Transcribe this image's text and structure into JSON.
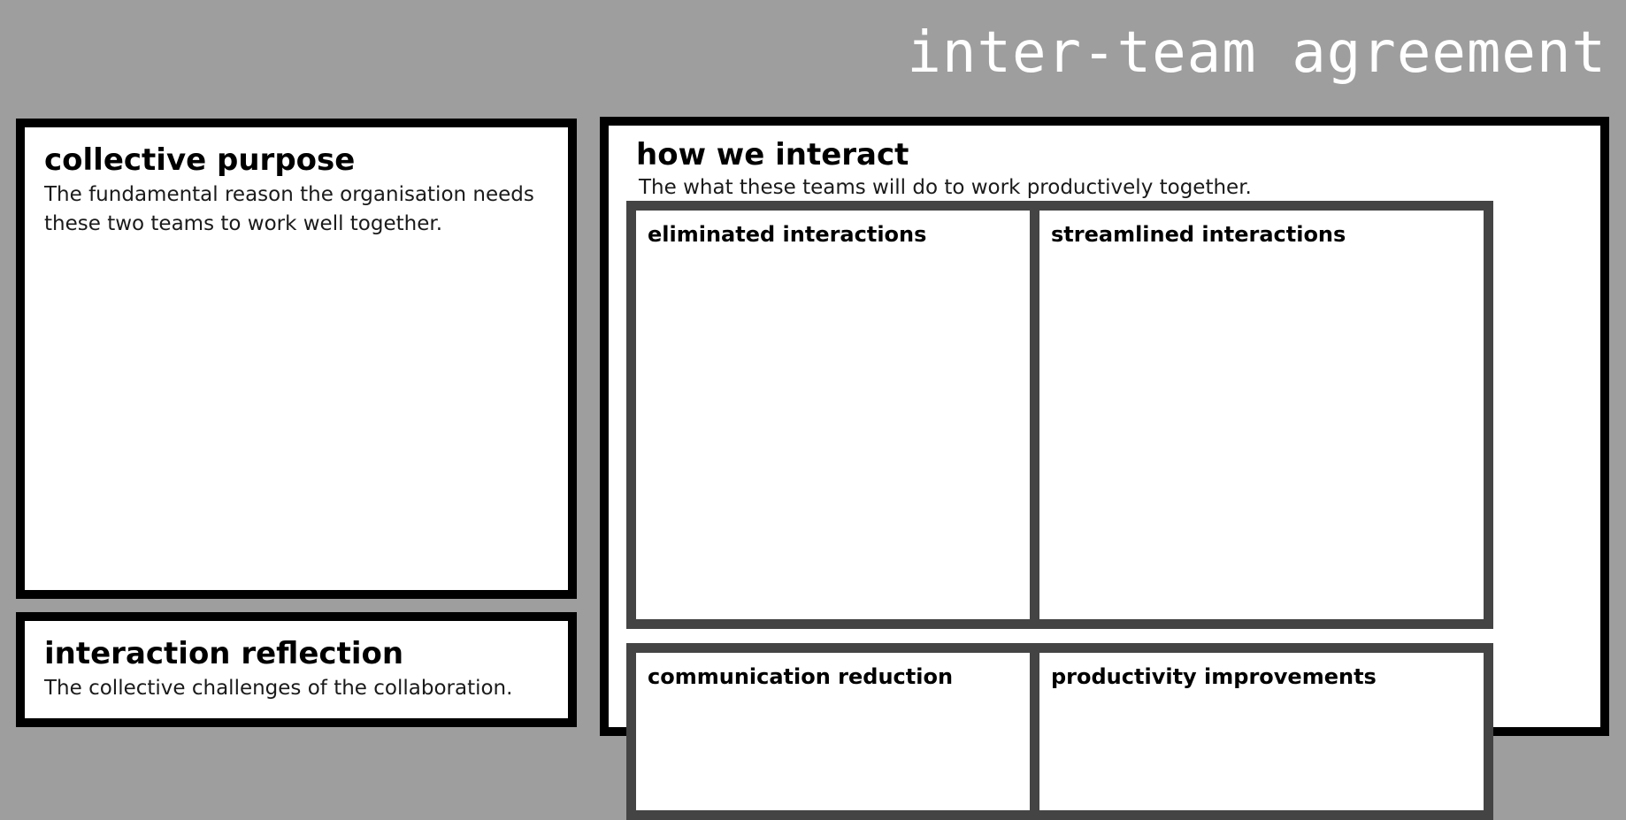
{
  "title": "inter-team agreement",
  "panels": {
    "collective_purpose": {
      "heading": "collective purpose",
      "description": "The fundamental reason the organisation needs these two teams to work well together."
    },
    "interaction_reflection": {
      "heading": "interaction reflection",
      "description": "The collective challenges of the collaboration."
    },
    "how_we_interact": {
      "heading": "how we interact",
      "description": "The what these teams will do to work productively together.",
      "boxes": {
        "eliminated": "eliminated interactions",
        "streamlined": "streamlined interactions",
        "communication": "communication reduction",
        "productivity": "productivity improvements"
      }
    }
  },
  "colors": {
    "background": "#9e9e9e",
    "panel_border": "#000000",
    "box_border": "#444444",
    "title_text": "#ffffff"
  }
}
